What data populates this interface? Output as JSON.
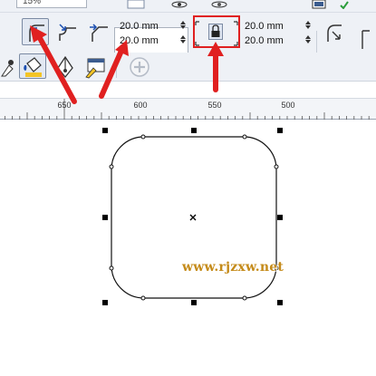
{
  "topbar": {
    "zoom_value": "15%"
  },
  "corner_options": {
    "modes": [
      "round-corner",
      "scallop-corner",
      "chamfer-corner"
    ]
  },
  "radius_fields": {
    "top_left": "20.0 mm",
    "bottom_left": "20.0 mm",
    "top_right": "20.0 mm",
    "bottom_right": "20.0 mm"
  },
  "ruler": {
    "labels": [
      "650",
      "600",
      "550",
      "500"
    ]
  },
  "watermark": {
    "text": "www.rjzxw.net"
  },
  "colors": {
    "annotation": "#e02020",
    "watermark": "#c58b1a",
    "toolbar_bg": "#eef1f6"
  }
}
